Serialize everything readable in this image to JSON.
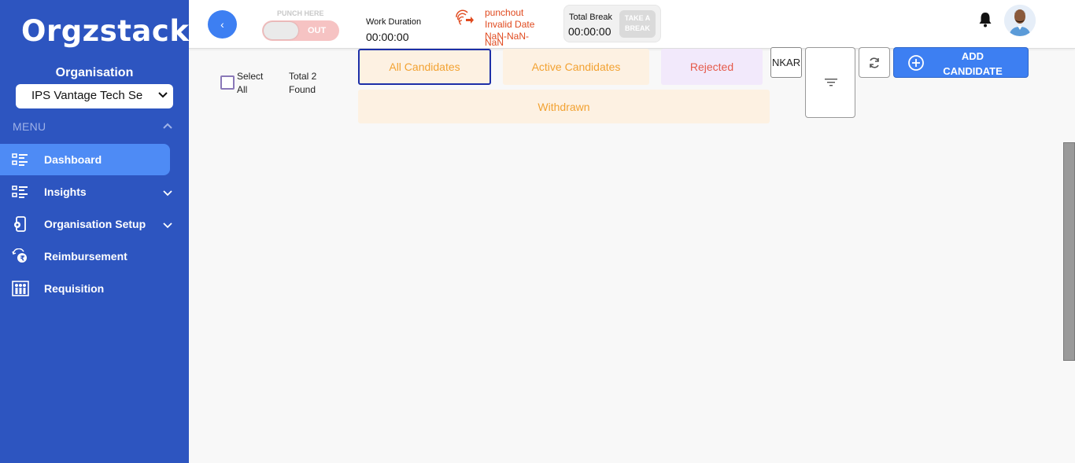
{
  "sidebar": {
    "logo": "Orgzstack",
    "org_label": "Organisation",
    "org_selected": "IPS Vantage Tech Se",
    "menu_title": "MENU",
    "items": [
      {
        "label": "Dashboard",
        "icon": "list-icon",
        "active": true,
        "expandable": false
      },
      {
        "label": "Insights",
        "icon": "list-icon",
        "active": false,
        "expandable": true
      },
      {
        "label": "Organisation Setup",
        "icon": "phone-settings-icon",
        "active": false,
        "expandable": true
      },
      {
        "label": "Reimbursement",
        "icon": "money-exchange-icon",
        "active": false,
        "expandable": false
      },
      {
        "label": "Requisition",
        "icon": "people-icon",
        "active": false,
        "expandable": false
      }
    ]
  },
  "header": {
    "back_label": "‹",
    "punch_label": "PUNCH HERE",
    "punch_state": "OUT",
    "work_duration_label": "Work Duration",
    "work_duration_value": "00:00:00",
    "punch_status_line1": "punchout",
    "punch_status_line2": "Invalid Date",
    "punch_status_line3": "NaN-NaN-",
    "punch_status_line4": "NaN",
    "total_break_label": "Total Break",
    "total_break_value": "00:00:00",
    "take_break_line1": "TAKE A",
    "take_break_line2": "BREAK"
  },
  "main": {
    "select_all_line1": "Select",
    "select_all_line2": "All",
    "total_line1": "Total 2",
    "total_line2": "Found",
    "tabs": [
      {
        "label": "All Candidates",
        "selected": true
      },
      {
        "label": "Active Candidates",
        "selected": false
      },
      {
        "label": "Rejected",
        "selected": false
      },
      {
        "label": "Withdrawn",
        "selected": false
      }
    ],
    "search_value": "NKAR",
    "add_label_line1": "ADD",
    "add_label_line2": "CANDIDATE"
  },
  "colors": {
    "sidebar_bg": "#2d55c0",
    "active_item": "#4e8bf5",
    "accent_blue": "#3d7ff2",
    "tab_orange_bg": "#fdf1e2",
    "tab_orange_text": "#f2a232",
    "tab_purple_bg": "#f2e9fb",
    "punch_red": "#e04a1f"
  }
}
